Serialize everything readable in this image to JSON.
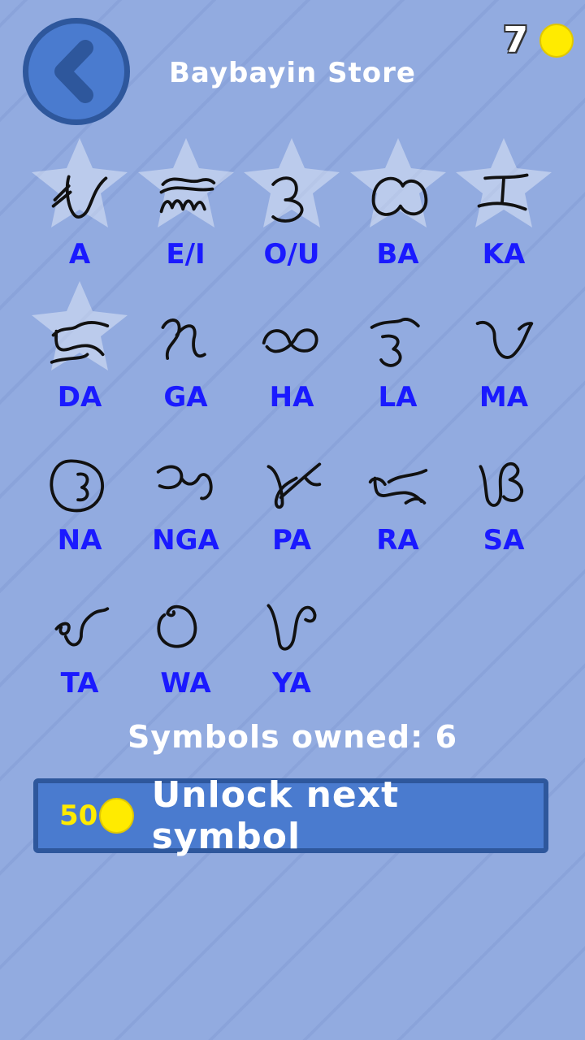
{
  "header": {
    "title": "Baybayin Store",
    "coin_balance": "7"
  },
  "symbols": [
    {
      "label": "A",
      "owned": true
    },
    {
      "label": "E/I",
      "owned": true
    },
    {
      "label": "O/U",
      "owned": true
    },
    {
      "label": "BA",
      "owned": true
    },
    {
      "label": "KA",
      "owned": true
    },
    {
      "label": "DA",
      "owned": true
    },
    {
      "label": "GA",
      "owned": false
    },
    {
      "label": "HA",
      "owned": false
    },
    {
      "label": "LA",
      "owned": false
    },
    {
      "label": "MA",
      "owned": false
    },
    {
      "label": "NA",
      "owned": false
    },
    {
      "label": "NGA",
      "owned": false
    },
    {
      "label": "PA",
      "owned": false
    },
    {
      "label": "RA",
      "owned": false
    },
    {
      "label": "SA",
      "owned": false
    },
    {
      "label": "TA",
      "owned": false
    },
    {
      "label": "WA",
      "owned": false
    },
    {
      "label": "YA",
      "owned": false
    }
  ],
  "status": {
    "owned_text": "Symbols owned: 6"
  },
  "unlock_button": {
    "price": "50",
    "label": "Unlock next symbol"
  },
  "colors": {
    "label": "#1a1aff",
    "coin": "#ffeb00",
    "button": "#4a7bcf",
    "button_border": "#2e579c",
    "background": "#92abe0"
  },
  "icons": {
    "back": "chevron-left-icon",
    "coin": "coin-icon",
    "owned_marker": "star-icon"
  }
}
